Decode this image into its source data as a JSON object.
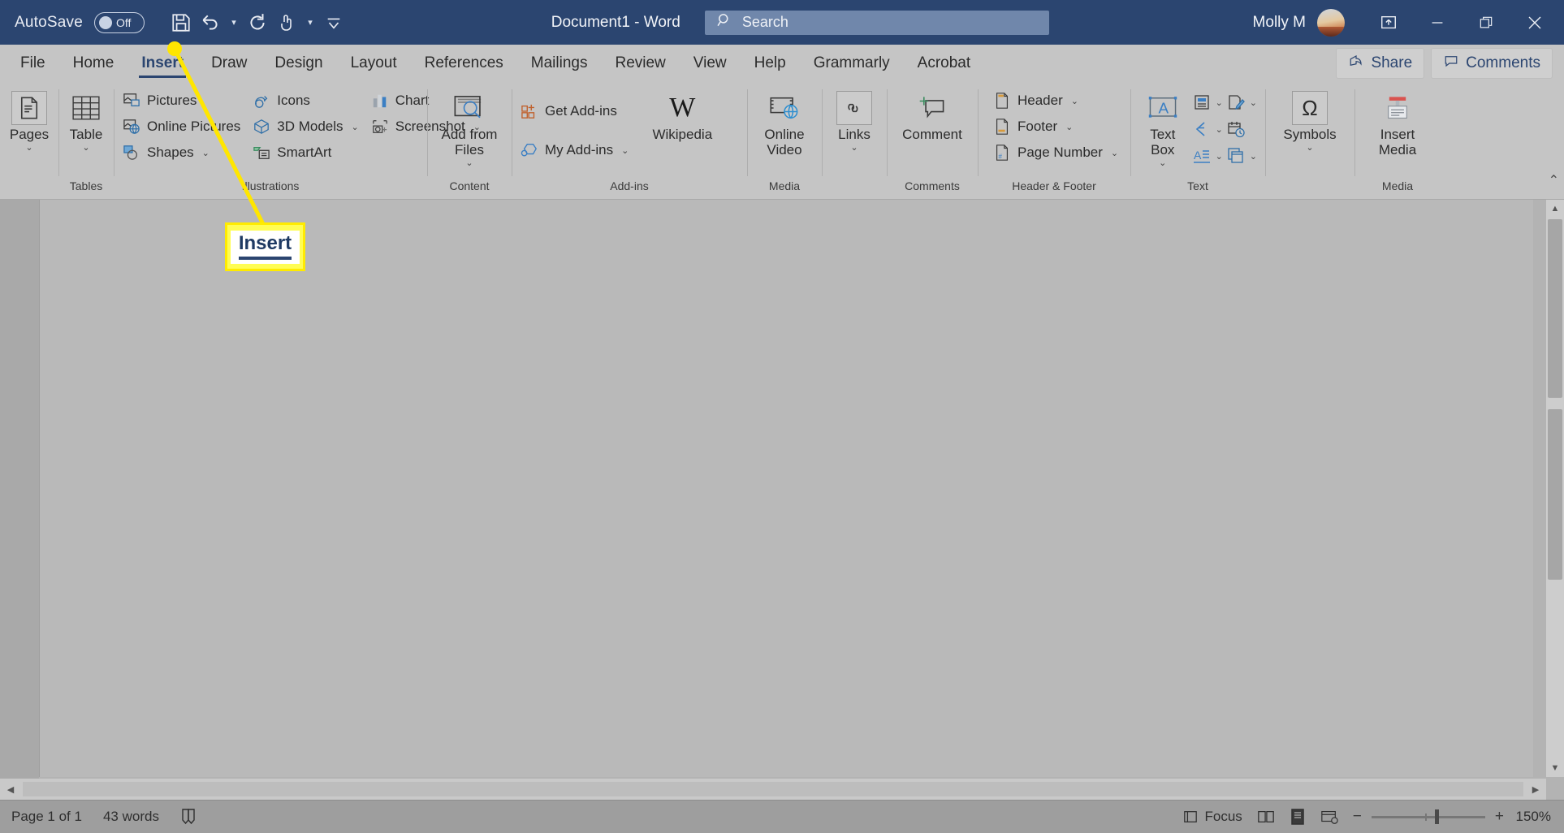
{
  "titlebar": {
    "autosave_label": "AutoSave",
    "autosave_state": "Off",
    "document_title": "Document1  -  Word",
    "search_placeholder": "Search",
    "user_name": "Molly M",
    "qat": [
      {
        "name": "save-button",
        "glyph": "💾"
      },
      {
        "name": "undo-button",
        "glyph": "↶"
      },
      {
        "name": "redo-button",
        "glyph": "↻"
      },
      {
        "name": "touch-mode-button",
        "glyph": "☝"
      },
      {
        "name": "customize-qat-button",
        "glyph": "⌄"
      }
    ],
    "window_buttons": [
      {
        "name": "ribbon-display-options-button",
        "glyph": "⬆"
      },
      {
        "name": "minimize-button",
        "glyph": "—"
      },
      {
        "name": "restore-button",
        "glyph": "❐"
      },
      {
        "name": "close-button",
        "glyph": "✕"
      }
    ]
  },
  "tabs": [
    {
      "label": "File",
      "active": false
    },
    {
      "label": "Home",
      "active": false
    },
    {
      "label": "Insert",
      "active": true
    },
    {
      "label": "Draw",
      "active": false
    },
    {
      "label": "Design",
      "active": false
    },
    {
      "label": "Layout",
      "active": false
    },
    {
      "label": "References",
      "active": false
    },
    {
      "label": "Mailings",
      "active": false
    },
    {
      "label": "Review",
      "active": false
    },
    {
      "label": "View",
      "active": false
    },
    {
      "label": "Help",
      "active": false
    },
    {
      "label": "Grammarly",
      "active": false
    },
    {
      "label": "Acrobat",
      "active": false
    }
  ],
  "tabstrip_right": {
    "share_label": "Share",
    "comments_label": "Comments"
  },
  "ribbon": {
    "groups": [
      {
        "name": "pages",
        "label": "",
        "big": [
          {
            "label": "Pages",
            "caret": "⌄"
          }
        ]
      },
      {
        "name": "tables",
        "label": "Tables",
        "big": [
          {
            "label": "Table",
            "caret": "⌄"
          }
        ]
      },
      {
        "name": "illustrations",
        "label": "Illustrations",
        "col1": [
          {
            "label": "Pictures",
            "caret": ""
          },
          {
            "label": "Online Pictures",
            "caret": ""
          },
          {
            "label": "Shapes",
            "caret": "⌄"
          }
        ],
        "col2": [
          {
            "label": "Icons",
            "caret": ""
          },
          {
            "label": "3D Models",
            "caret": "⌄"
          },
          {
            "label": "SmartArt",
            "caret": ""
          }
        ],
        "col3": [
          {
            "label": "Chart",
            "caret": ""
          },
          {
            "label": "Screenshot",
            "caret": "⌄"
          }
        ]
      },
      {
        "name": "content",
        "label": "Content",
        "big": [
          {
            "label": "Add from Files",
            "caret": "⌄"
          }
        ]
      },
      {
        "name": "add-ins",
        "label": "Add-ins",
        "col1": [
          {
            "label": "Get Add-ins",
            "caret": ""
          },
          {
            "label": "My Add-ins",
            "caret": "⌄"
          }
        ],
        "big": [
          {
            "label": "Wikipedia",
            "caret": ""
          }
        ]
      },
      {
        "name": "media",
        "label": "Media",
        "big": [
          {
            "label": "Online Video",
            "caret": ""
          }
        ]
      },
      {
        "name": "links",
        "label": "",
        "big": [
          {
            "label": "Links",
            "caret": "⌄"
          }
        ]
      },
      {
        "name": "comments",
        "label": "Comments",
        "big": [
          {
            "label": "Comment",
            "caret": ""
          }
        ]
      },
      {
        "name": "header-footer",
        "label": "Header & Footer",
        "col1": [
          {
            "label": "Header",
            "caret": "⌄"
          },
          {
            "label": "Footer",
            "caret": "⌄"
          },
          {
            "label": "Page Number",
            "caret": "⌄"
          }
        ]
      },
      {
        "name": "text",
        "label": "Text",
        "big": [
          {
            "label": "Text Box",
            "caret": "⌄"
          }
        ],
        "mini": [
          {
            "name": "quick-parts-icon",
            "caret": "⌄"
          },
          {
            "name": "wordart-icon",
            "caret": "⌄"
          },
          {
            "name": "drop-cap-icon",
            "caret": "⌄"
          },
          {
            "name": "signature-line-icon",
            "caret": "⌄"
          },
          {
            "name": "date-time-icon",
            "caret": ""
          },
          {
            "name": "object-icon",
            "caret": "⌄"
          }
        ]
      },
      {
        "name": "symbols",
        "label": "",
        "big": [
          {
            "label": "Symbols",
            "caret": "⌄"
          }
        ]
      },
      {
        "name": "media-2",
        "label": "Media",
        "big": [
          {
            "label": "Insert Media",
            "caret": ""
          }
        ]
      }
    ],
    "collapse_glyph": "⌃"
  },
  "annotation": {
    "callout_text": "Insert",
    "highlight_color": "#fffd54",
    "border_color": "#ffeb00",
    "line_color": "#ffe600"
  },
  "statusbar": {
    "page_info": "Page 1 of 1",
    "word_count": "43 words",
    "proofing_icon": "proofing-icon",
    "focus_label": "Focus",
    "view_buttons": [
      {
        "name": "read-mode-button"
      },
      {
        "name": "print-layout-button"
      },
      {
        "name": "web-layout-button"
      }
    ],
    "zoom_out": "−",
    "zoom_in": "+",
    "zoom_level": "150%"
  },
  "scroll": {
    "up_glyph": "▲",
    "down_glyph": "▼",
    "left_glyph": "◀",
    "right_glyph": "▶"
  }
}
